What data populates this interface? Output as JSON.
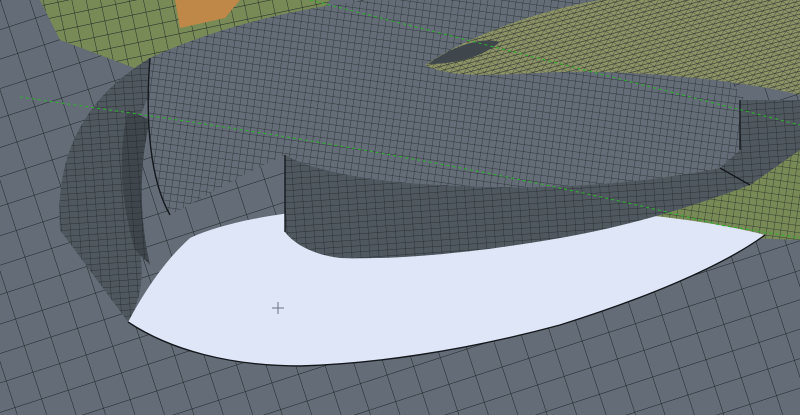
{
  "viewport": {
    "title": "",
    "colors": {
      "background": "#dfe6f8",
      "mesh_face": "#646d77",
      "mesh_face_shade": "#50585f",
      "mesh_face_dark": "#3f464c",
      "mesh_line": "#1e2328",
      "olive_region": "#788a55",
      "orange_region": "#c08848",
      "dense_region": "#8e9466",
      "dashed_line": "#2eaf2e"
    },
    "cursor_icon": "crosshair-icon"
  }
}
